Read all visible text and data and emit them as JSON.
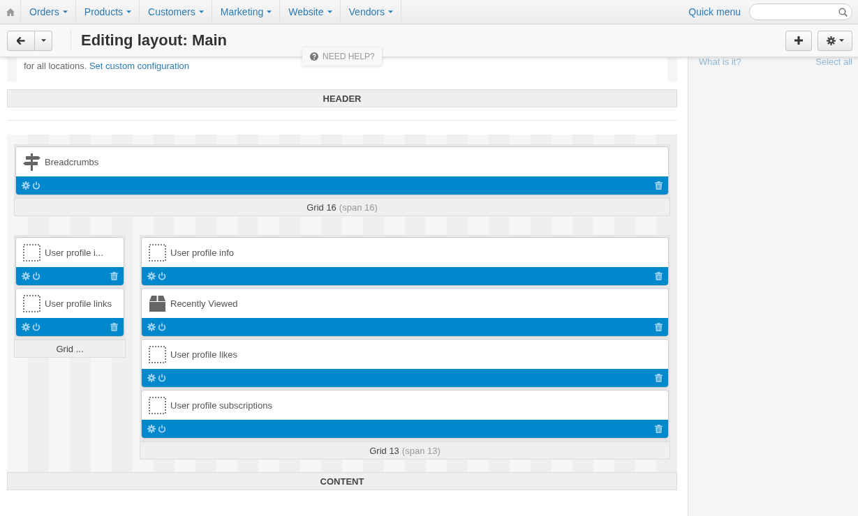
{
  "top_nav": {
    "items": [
      {
        "label": "Orders"
      },
      {
        "label": "Products"
      },
      {
        "label": "Customers"
      },
      {
        "label": "Marketing"
      },
      {
        "label": "Website"
      },
      {
        "label": "Vendors"
      }
    ],
    "quick_menu": "Quick menu"
  },
  "toolbar": {
    "title": "Editing layout: Main",
    "help": "NEED HELP?"
  },
  "notice": {
    "text": "for all locations.",
    "link": "Set custom configuration"
  },
  "header_container": "HEADER",
  "grids": [
    {
      "title": "Grid 16",
      "span": "(span 16)",
      "blocks": [
        {
          "name": "Breadcrumbs",
          "kind": "signpost"
        }
      ]
    },
    {
      "title": "Grid ...",
      "blocks": [
        {
          "name": "User profile i...",
          "kind": "placeholder"
        },
        {
          "name": "User profile links",
          "kind": "placeholder"
        }
      ]
    },
    {
      "title": "Grid 13",
      "span": "(span 13)",
      "blocks": [
        {
          "name": "User profile info",
          "kind": "placeholder"
        },
        {
          "name": "Recently Viewed",
          "kind": "box"
        },
        {
          "name": "User profile likes",
          "kind": "placeholder"
        },
        {
          "name": "User profile subscriptions",
          "kind": "placeholder"
        }
      ]
    }
  ],
  "content_container": "CONTENT",
  "sidebar": {
    "left_link": "What is it?",
    "right_link": "Select all"
  }
}
